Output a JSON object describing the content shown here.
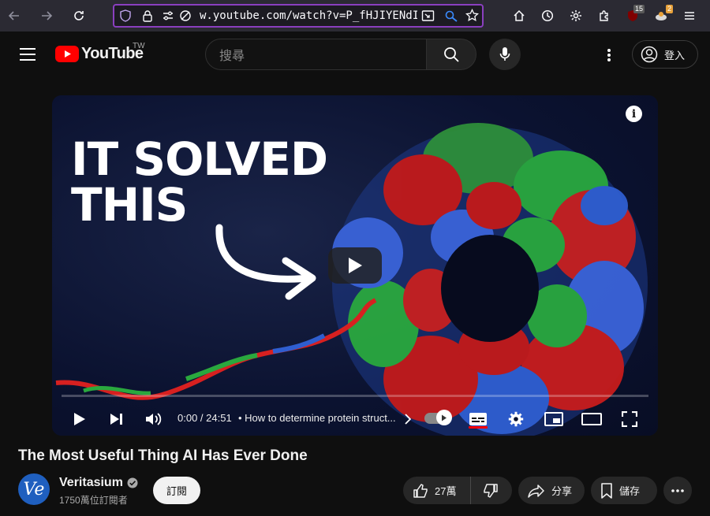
{
  "browser": {
    "url": "w.youtube.com/watch?v=P_fHJIYENdI",
    "badges": {
      "extension_count": "15",
      "extension_count2": "2"
    }
  },
  "header": {
    "logo_text": "YouTube",
    "region": "TW",
    "search_placeholder": "搜尋",
    "signin_label": "登入"
  },
  "player": {
    "thumbnail_headline_line1": "IT SOLVED",
    "thumbnail_headline_line2": "THIS",
    "time_current": "0:00",
    "time_total": "24:51",
    "time_display": "0:00 / 24:51",
    "chapter": "How to determine protein struct...",
    "progress": 0.0
  },
  "video": {
    "title": "The Most Useful Thing AI Has Ever Done",
    "channel_name": "Veritasium",
    "channel_avatar_text": "Ve",
    "subscriber_count": "1750萬位訂閱者",
    "subscribe_label": "訂閱",
    "like_count": "27萬",
    "share_label": "分享",
    "save_label": "儲存"
  },
  "colors": {
    "accent": "#ff0000",
    "url_focus": "#8a3fbf",
    "avatar_bg": "#1f5fbf"
  }
}
